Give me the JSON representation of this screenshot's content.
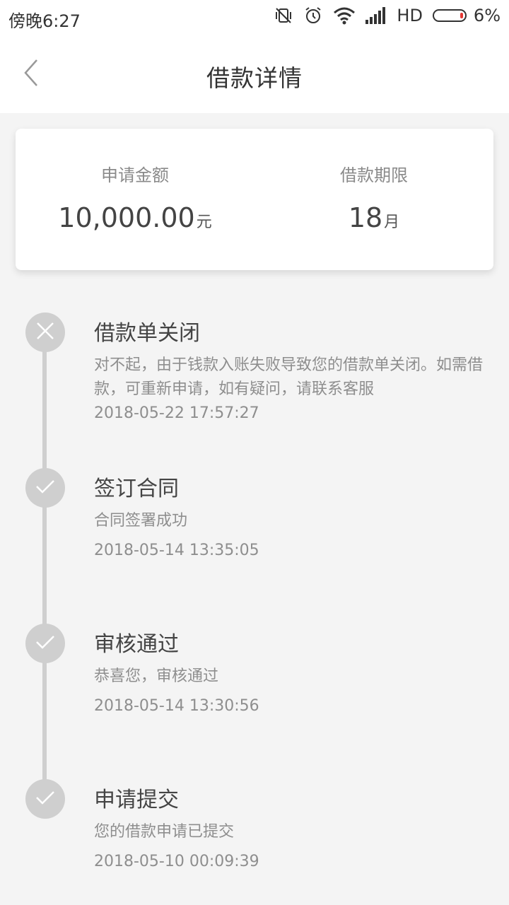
{
  "status_bar": {
    "time": "傍晚6:27",
    "network": "HD",
    "battery": "6%"
  },
  "nav": {
    "title": "借款详情"
  },
  "summary": {
    "amount_label": "申请金额",
    "amount_value": "10,000.00",
    "amount_unit": "元",
    "term_label": "借款期限",
    "term_value": "18",
    "term_unit": "月"
  },
  "timeline": [
    {
      "status": "closed",
      "title": "借款单关闭",
      "desc": "对不起，由于钱款入账失败导致您的借款单关闭。如需借款，可重新申请，如有疑问，请联系客服",
      "time": "2018-05-22 17:57:27"
    },
    {
      "status": "done",
      "title": "签订合同",
      "desc": "合同签署成功",
      "time": "2018-05-14 13:35:05"
    },
    {
      "status": "done",
      "title": "审核通过",
      "desc": "恭喜您，审核通过",
      "time": "2018-05-14 13:30:56"
    },
    {
      "status": "done",
      "title": "申请提交",
      "desc": "您的借款申请已提交",
      "time": "2018-05-10 00:09:39"
    }
  ],
  "icons": {
    "back": "chevron-left-icon",
    "closed": "close-icon",
    "done": "check-icon"
  },
  "colors": {
    "timeline": "#cfcfcf",
    "background": "#f4f4f4"
  }
}
